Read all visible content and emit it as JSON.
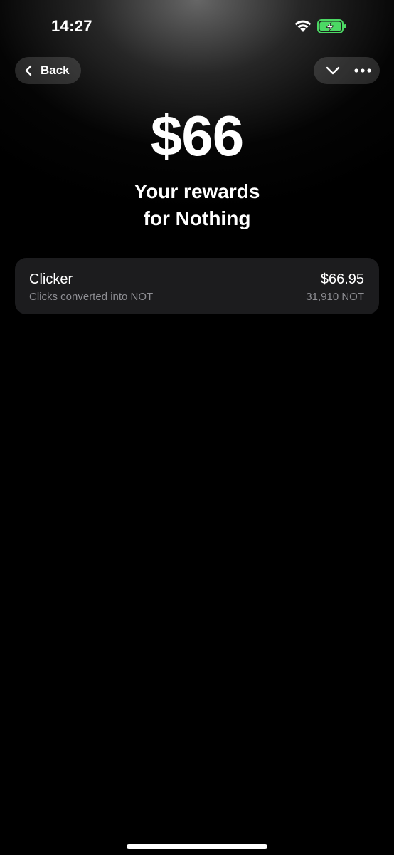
{
  "status_bar": {
    "time": "14:27",
    "wifi_icon": "wifi-icon",
    "battery_icon": "battery-charging-icon",
    "battery_color": "#4cd964"
  },
  "nav": {
    "back_label": "Back",
    "back_icon": "chevron-left-icon",
    "collapse_icon": "chevron-down-icon",
    "more_icon": "more-icon"
  },
  "hero": {
    "amount": "$66",
    "subtitle_line1": "Your rewards",
    "subtitle_line2": "for Nothing"
  },
  "rewards": [
    {
      "title": "Clicker",
      "description": "Clicks converted into NOT",
      "usd_value": "$66.95",
      "not_value": "31,910 NOT"
    }
  ]
}
